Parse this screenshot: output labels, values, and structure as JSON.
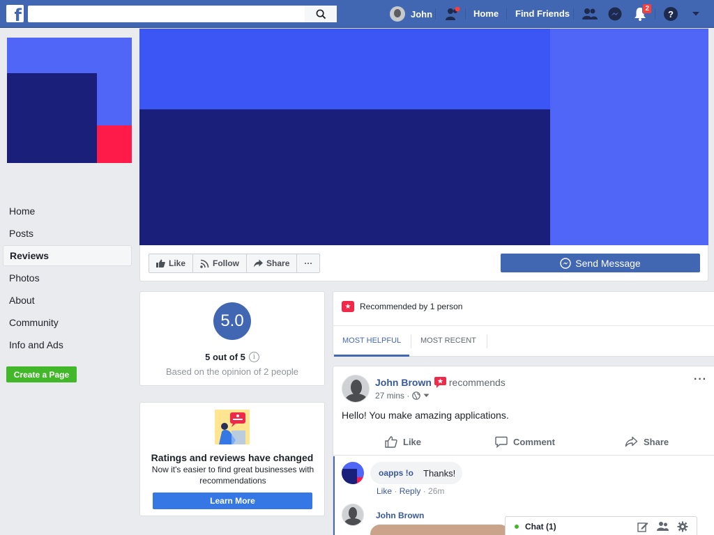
{
  "topbar": {
    "logo_letter": "f",
    "search_placeholder": "",
    "user_name": "John",
    "nav_home": "Home",
    "nav_find_friends": "Find Friends",
    "notifications_count": "2",
    "help_symbol": "?",
    "colors": {
      "bar": "#4267b2",
      "badge": "#fa3e3e"
    }
  },
  "sidebar": {
    "items": [
      {
        "label": "Home"
      },
      {
        "label": "Posts"
      },
      {
        "label": "Reviews"
      },
      {
        "label": "Photos"
      },
      {
        "label": "About"
      },
      {
        "label": "Community"
      },
      {
        "label": "Info and Ads"
      }
    ],
    "create_page": "Create a Page"
  },
  "actions": {
    "like": "Like",
    "follow": "Follow",
    "share": "Share",
    "more": "···",
    "send_message": "Send Message"
  },
  "rating": {
    "score": "5.0",
    "summary": "5 out of 5",
    "info_symbol": "i",
    "basis": "Based on the opinion of 2 people"
  },
  "promo": {
    "title": "Ratings and reviews have changed",
    "text": "Now it's easier to find great businesses with recommendations",
    "button": "Learn More"
  },
  "reviews": {
    "recommended_by": "Recommended by 1 person",
    "tabs": [
      {
        "label": "MOST HELPFUL"
      },
      {
        "label": "MOST RECENT"
      }
    ]
  },
  "post": {
    "author": "John Brown",
    "verb": "recommends",
    "time": "27 mins ·",
    "text": "Hello! You make amazing applications.",
    "more": "···",
    "actions": {
      "like": "Like",
      "comment": "Comment",
      "share": "Share"
    }
  },
  "comments": [
    {
      "name": "oapps !o",
      "text": "Thanks!",
      "like": "Like",
      "reply": "Reply",
      "time": "· 26m"
    },
    {
      "name": "John Brown"
    }
  ],
  "chat": {
    "label": "Chat (1)"
  }
}
